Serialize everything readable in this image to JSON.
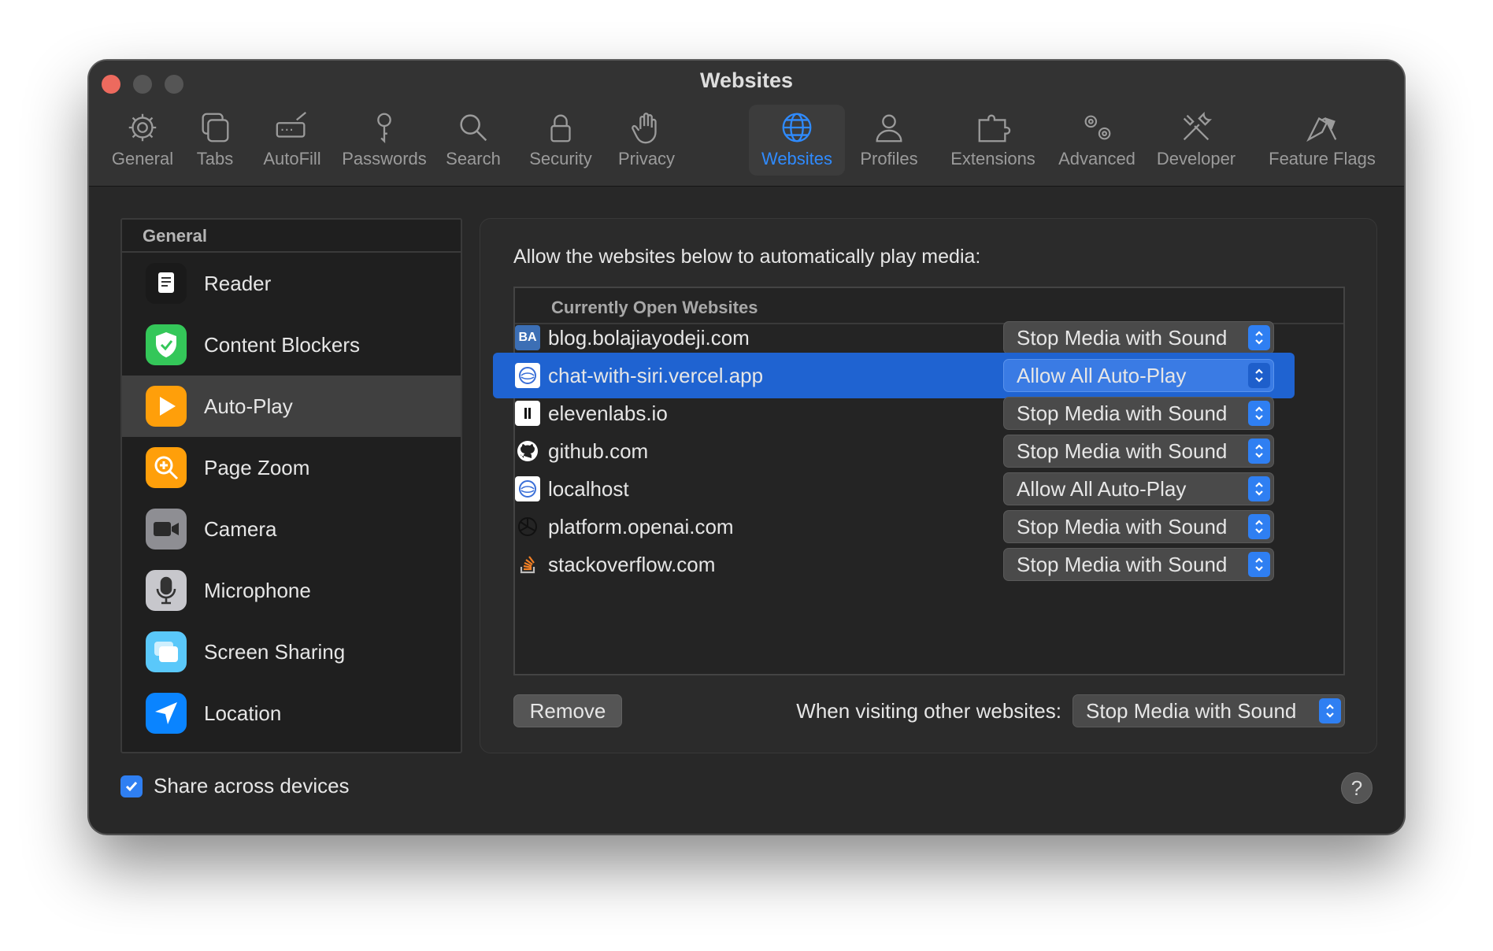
{
  "window": {
    "title": "Websites"
  },
  "toolbar": {
    "items": [
      {
        "label": "General",
        "icon": "gear-icon"
      },
      {
        "label": "Tabs",
        "icon": "tabs-icon"
      },
      {
        "label": "AutoFill",
        "icon": "autofill-icon"
      },
      {
        "label": "Passwords",
        "icon": "key-icon"
      },
      {
        "label": "Search",
        "icon": "magnifier-icon"
      },
      {
        "label": "Security",
        "icon": "lock-icon"
      },
      {
        "label": "Privacy",
        "icon": "hand-icon"
      },
      {
        "label": "Websites",
        "icon": "globe-icon",
        "active": true
      },
      {
        "label": "Profiles",
        "icon": "person-icon"
      },
      {
        "label": "Extensions",
        "icon": "puzzle-icon"
      },
      {
        "label": "Advanced",
        "icon": "gears-icon"
      },
      {
        "label": "Developer",
        "icon": "tools-icon"
      },
      {
        "label": "Feature Flags",
        "icon": "flags-icon"
      }
    ]
  },
  "sidebar": {
    "header": "General",
    "items": [
      {
        "label": "Reader",
        "icon": "reader-icon",
        "color": "#1a1a1a"
      },
      {
        "label": "Content Blockers",
        "icon": "shield-icon",
        "color": "#34c759"
      },
      {
        "label": "Auto-Play",
        "icon": "play-icon",
        "color": "#ff9f0a",
        "selected": true
      },
      {
        "label": "Page Zoom",
        "icon": "zoom-icon",
        "color": "#ff9f0a"
      },
      {
        "label": "Camera",
        "icon": "camera-icon",
        "color": "#8e8e93"
      },
      {
        "label": "Microphone",
        "icon": "microphone-icon",
        "color": "#c7c7cc"
      },
      {
        "label": "Screen Sharing",
        "icon": "screen-sharing-icon",
        "color": "#5ac8fa"
      },
      {
        "label": "Location",
        "icon": "location-arrow-icon",
        "color": "#0a84ff"
      }
    ]
  },
  "panel": {
    "title": "Allow the websites below to automatically play media:",
    "table_header": "Currently Open Websites",
    "sites": [
      {
        "name": "blog.bolajiayodeji.com",
        "setting": "Stop Media with Sound",
        "favicon_text": "BA"
      },
      {
        "name": "chat-with-siri.vercel.app",
        "setting": "Allow All Auto-Play",
        "selected": true
      },
      {
        "name": "elevenlabs.io",
        "setting": "Stop Media with Sound"
      },
      {
        "name": "github.com",
        "setting": "Stop Media with Sound"
      },
      {
        "name": "localhost",
        "setting": "Allow All Auto-Play"
      },
      {
        "name": "platform.openai.com",
        "setting": "Stop Media with Sound"
      },
      {
        "name": "stackoverflow.com",
        "setting": "Stop Media with Sound"
      }
    ],
    "remove_label": "Remove",
    "other_label": "When visiting other websites:",
    "other_setting": "Stop Media with Sound"
  },
  "footer": {
    "share_label": "Share across devices",
    "share_checked": true,
    "help_label": "?"
  },
  "colors": {
    "accent": "#2f7ff2",
    "selection": "#1f63d1",
    "close": "#ed6a5e"
  }
}
